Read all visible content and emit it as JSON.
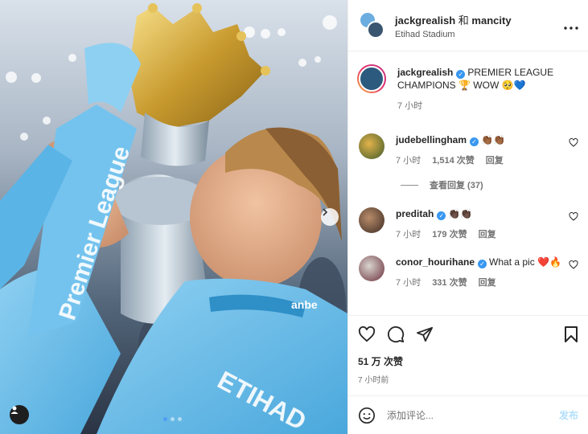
{
  "header": {
    "username": "jackgrealish",
    "conjunction": "和",
    "collaborator": "mancity",
    "location": "Etihad Stadium",
    "more_icon": "more-horizontal-icon"
  },
  "photo": {
    "banner_text": "Premier League",
    "kit_text": "ETIHAD",
    "sponsor_text": "anbe",
    "carousel": {
      "count": 3,
      "active_index": 0
    }
  },
  "caption": {
    "username": "jackgrealish",
    "text": "PREMIER LEAGUE CHAMPIONS 🏆 WOW 🥺💙",
    "time": "7 小时"
  },
  "comments": [
    {
      "username": "judebellingham",
      "text": "👏🏾👏🏾",
      "time": "7 小时",
      "likes": "1,514 次赞",
      "reply_label": "回复"
    },
    {
      "username": "preditah",
      "text": "👏🏿👏🏿",
      "time": "7 小时",
      "likes": "179 次赞",
      "reply_label": "回复"
    },
    {
      "username": "conor_hourihane",
      "text": "What a pic ❤️🔥",
      "time": "7 小时",
      "likes": "331 次赞",
      "reply_label": "回复"
    }
  ],
  "view_replies_label": "查看回复 (37)",
  "actions": {
    "likes": "51 万 次赞",
    "time": "7 小时前"
  },
  "add_comment": {
    "placeholder": "添加评论...",
    "post_label": "发布"
  },
  "colors": {
    "verified": "#3897f0",
    "post_button": "#b2dffc",
    "accent_blue": "#4f9df6"
  }
}
